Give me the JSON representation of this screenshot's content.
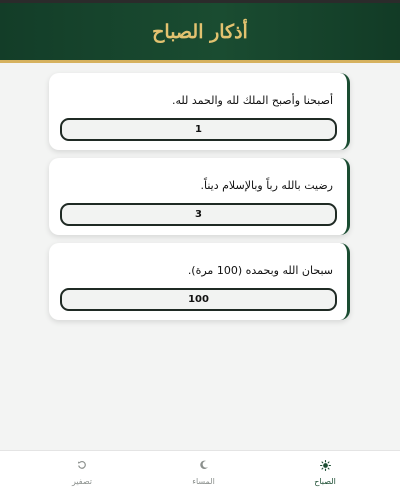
{
  "header": {
    "title": "أذكار الصباح"
  },
  "adhkar": [
    {
      "text": "أصبحنا وأصبح الملك لله والحمد لله.",
      "count": "1"
    },
    {
      "text": "رضيت بالله رباً وبالإسلام ديناً.",
      "count": "3"
    },
    {
      "text": "سبحان الله وبحمده (100 مرة).",
      "count": "100"
    }
  ],
  "bottom_nav": {
    "morning": {
      "label": "الصباح",
      "icon": "sun-icon"
    },
    "evening": {
      "label": "المساء",
      "icon": "moon-icon"
    },
    "reset": {
      "label": "تصفير",
      "icon": "reset-icon"
    }
  },
  "colors": {
    "primary": "#1a4c31",
    "gold": "#d6b25f",
    "background": "#f3f4f3"
  }
}
